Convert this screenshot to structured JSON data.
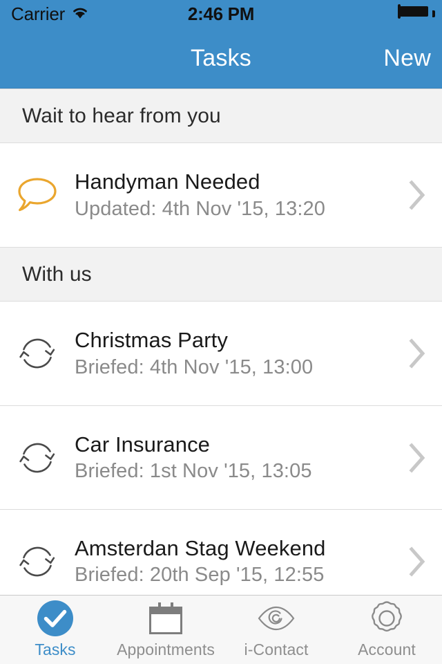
{
  "status_bar": {
    "carrier": "Carrier",
    "wifi_icon": "wifi-icon",
    "time": "2:46 PM",
    "battery_icon": "battery-full-icon"
  },
  "nav_bar": {
    "title": "Tasks",
    "action_label": "New",
    "background_color": "#3d8dc8"
  },
  "sections": [
    {
      "header": "Wait to hear from you",
      "rows": [
        {
          "icon": "speech-bubble-icon",
          "icon_color": "#eaa62e",
          "title": "Handyman Needed",
          "subtitle": "Updated: 4th Nov '15, 13:20",
          "chevron": "chevron-right-icon"
        }
      ]
    },
    {
      "header": "With us",
      "rows": [
        {
          "icon": "sync-arrows-icon",
          "icon_color": "#4a4a4a",
          "title": "Christmas Party",
          "subtitle": "Briefed: 4th Nov '15, 13:00",
          "chevron": "chevron-right-icon"
        },
        {
          "icon": "sync-arrows-icon",
          "icon_color": "#4a4a4a",
          "title": "Car Insurance",
          "subtitle": "Briefed: 1st Nov '15, 13:05",
          "chevron": "chevron-right-icon"
        },
        {
          "icon": "sync-arrows-icon",
          "icon_color": "#4a4a4a",
          "title": "Amsterdan Stag Weekend",
          "subtitle": "Briefed: 20th Sep '15, 12:55",
          "chevron": "chevron-right-icon"
        }
      ]
    }
  ],
  "tab_bar": {
    "active_color": "#3d8dc8",
    "inactive_color": "#8e8e8e",
    "items": [
      {
        "label": "Tasks",
        "icon": "check-circle-icon",
        "active": true
      },
      {
        "label": "Appointments",
        "icon": "calendar-icon",
        "active": false
      },
      {
        "label": "i-Contact",
        "icon": "eye-icon",
        "active": false
      },
      {
        "label": "Account",
        "icon": "gear-icon",
        "active": false
      }
    ]
  }
}
